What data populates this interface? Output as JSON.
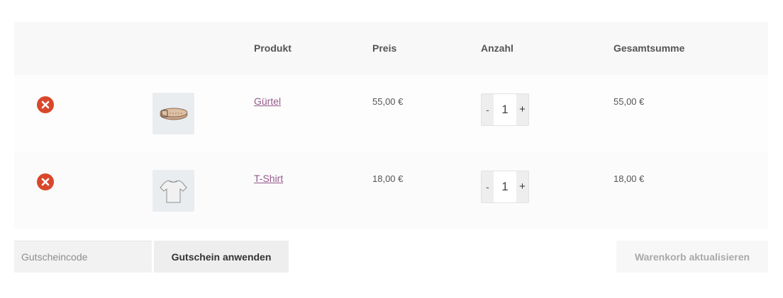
{
  "table": {
    "headers": {
      "remove": "",
      "thumbnail": "",
      "product": "Produkt",
      "price": "Preis",
      "quantity": "Anzahl",
      "subtotal": "Gesamtsumme"
    }
  },
  "items": [
    {
      "name": "Gürtel",
      "price": "55,00 €",
      "quantity": "1",
      "subtotal": "55,00 €",
      "thumbnail_icon": "belt-icon"
    },
    {
      "name": "T-Shirt",
      "price": "18,00 €",
      "quantity": "1",
      "subtotal": "18,00 €",
      "thumbnail_icon": "tshirt-icon"
    }
  ],
  "quantity_controls": {
    "minus": "-",
    "plus": "+"
  },
  "coupon": {
    "placeholder": "Gutscheincode",
    "value": "",
    "apply_label": "Gutschein anwenden"
  },
  "update_cart_label": "Warenkorb aktualisieren",
  "colors": {
    "remove": "#d9472b",
    "link": "#96588a",
    "header_bg": "#f8f8f8"
  }
}
